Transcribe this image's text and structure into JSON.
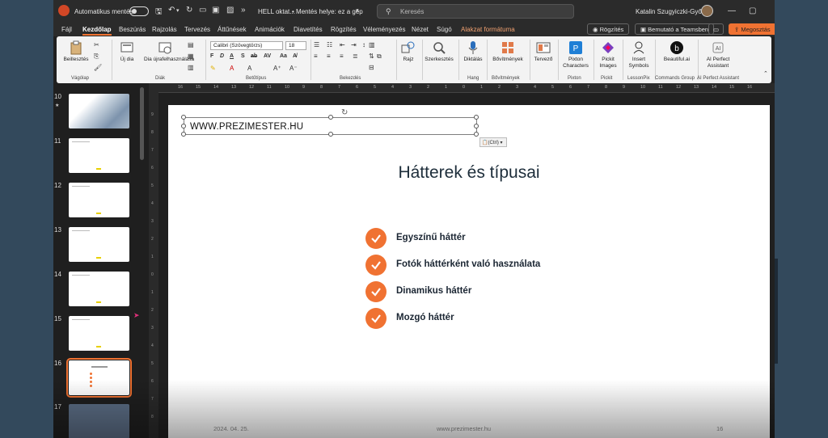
{
  "titlebar": {
    "autosave_label": "Automatikus mentés",
    "doc_name": "HELL oktat...",
    "save_location": "• Mentés helye: ez a gép",
    "search_placeholder": "Keresés",
    "user_name": "Katalin Szugyiczki-Győrfi"
  },
  "menu": {
    "tabs": [
      "Fájl",
      "Kezdőlap",
      "Beszúrás",
      "Rajzolás",
      "Tervezés",
      "Áttűnések",
      "Animációk",
      "Diavetítés",
      "Rögzítés",
      "Véleményezés",
      "Nézet",
      "Súgó",
      "Alakzat formátuma"
    ],
    "active_tab": "Kezdőlap",
    "record": "Rögzítés",
    "present_teams": "Bemutató a Teamsben",
    "share": "Megosztás"
  },
  "ribbon": {
    "paste": "Beillesztés",
    "clipboard_group": "Vágólap",
    "new_slide": "Új dia",
    "reuse_slides": "Dia újrafelhasználása",
    "slides_group": "Diák",
    "font_name": "Calibri (Szövegtörzs)",
    "font_size": "18",
    "font_group": "Betűtípus",
    "paragraph_group": "Bekezdés",
    "drawing": "Rajz",
    "editing": "Szerkesztés",
    "dictate": "Diktálás",
    "voice_group": "Hang",
    "addins": "Bővítmények",
    "addins_group": "Bővítmények",
    "designer": "Tervező",
    "pixton": "Pixton Characters",
    "pixton_group": "Pixton",
    "pickit": "Pickit Images",
    "pickit_group": "Pickit",
    "insert_symbols": "Insert Symbols",
    "lessonpix_group": "LessonPix",
    "beautiful": "Beautiful.ai",
    "commands_group": "Commands Group",
    "ai_assistant": "AI Perfect Assistant",
    "ai_group": "AI Perfect Assistant"
  },
  "ruler": {
    "h_ticks": [
      "16",
      "15",
      "14",
      "13",
      "12",
      "11",
      "10",
      "9",
      "8",
      "7",
      "6",
      "5",
      "4",
      "3",
      "2",
      "1",
      "0",
      "1",
      "2",
      "3",
      "4",
      "5",
      "6",
      "7",
      "8",
      "9",
      "10",
      "11",
      "12",
      "13",
      "14",
      "15",
      "16"
    ],
    "v_ticks": [
      "9",
      "8",
      "7",
      "6",
      "5",
      "4",
      "3",
      "2",
      "1",
      "0",
      "1",
      "2",
      "3",
      "4",
      "5",
      "6",
      "7",
      "8"
    ]
  },
  "thumbnails": [
    {
      "num": "10",
      "star": "★"
    },
    {
      "num": "11"
    },
    {
      "num": "12"
    },
    {
      "num": "13"
    },
    {
      "num": "14"
    },
    {
      "num": "15"
    },
    {
      "num": "16"
    },
    {
      "num": "17"
    }
  ],
  "slide": {
    "textbox_text": "WWW.PREZIMESTER.HU",
    "paste_tag": "(Ctrl)",
    "title": "Hátterek és típusai",
    "bullets": [
      "Egyszínű háttér",
      "Fotók háttérként való használata",
      "Dinamikus háttér",
      "Mozgó háttér"
    ],
    "footer_date": "2024. 04. 25.",
    "footer_site": "www.prezimester.hu",
    "page_number": "16"
  },
  "colors": {
    "accent_orange": "#f07232",
    "title_text": "#1d2d3a"
  }
}
